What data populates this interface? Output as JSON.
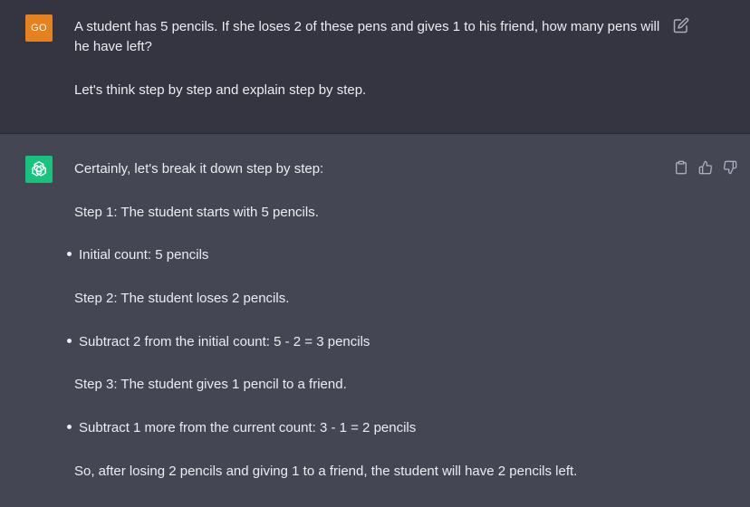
{
  "user_message": {
    "avatar_initials": "GO",
    "avatar_color": "#e5821f",
    "paragraphs": [
      "A student has 5 pencils. If she loses 2 of these pens and gives 1 to his friend, how many pens will he have left?",
      "Let's think step by step and explain step by step."
    ],
    "edit_icon": "edit-icon"
  },
  "assistant_message": {
    "avatar_icon": "openai-logo-icon",
    "avatar_color": "#19c37d",
    "intro": "Certainly, let's break it down step by step:",
    "step1": "Step 1: The student starts with 5 pencils.",
    "bullet1": "Initial count: 5 pencils",
    "step2": "Step 2: The student loses 2 pencils.",
    "bullet2": "Subtract 2 from the initial count: 5 - 2 = 3 pencils",
    "step3": "Step 3: The student gives 1 pencil to a friend.",
    "bullet3": "Subtract 1 more from the current count: 3 - 1 = 2 pencils",
    "conclusion": "So, after losing 2 pencils and giving 1 to a friend, the student will have 2 pencils left.",
    "action_icons": [
      "clipboard-icon",
      "thumbs-up-icon",
      "thumbs-down-icon"
    ]
  },
  "colors": {
    "user_bg": "#343541",
    "assistant_bg": "#444654",
    "text": "#ececf1"
  }
}
